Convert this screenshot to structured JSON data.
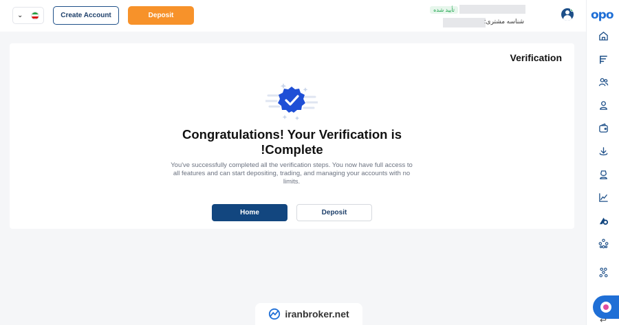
{
  "header": {
    "create_account": "Create Account",
    "deposit": "Deposit",
    "verified_label": "تأیید شده",
    "customer_id_label": "شناسه مشتری:"
  },
  "language": {
    "flag": "iran-flag-icon",
    "chevron": "chevron-down-icon"
  },
  "sidebar": {
    "logo": "opo",
    "items": [
      "home-icon",
      "flag-lines-icon",
      "users-icon",
      "user-icon",
      "wallet-icon",
      "download-icon",
      "badge-user-icon",
      "chart-line-icon",
      "brand-a-icon",
      "network-icon",
      "network-alt-icon",
      "logout-icon"
    ]
  },
  "main": {
    "title": "Verification",
    "headline_line1": "Congratulations! Your Verification is",
    "headline_line2": "!Complete",
    "description": "You've successfully completed all the verification steps. You now have full access to all features and can start depositing, trading, and managing your accounts with no limits.",
    "home_button": "Home",
    "deposit_button": "Deposit"
  },
  "watermark": {
    "text": "iranbroker.net"
  },
  "colors": {
    "primary": "#12467f",
    "accent_orange": "#f7922a",
    "brand_blue": "#1f6fd6",
    "verified_green": "#1aa34a"
  }
}
